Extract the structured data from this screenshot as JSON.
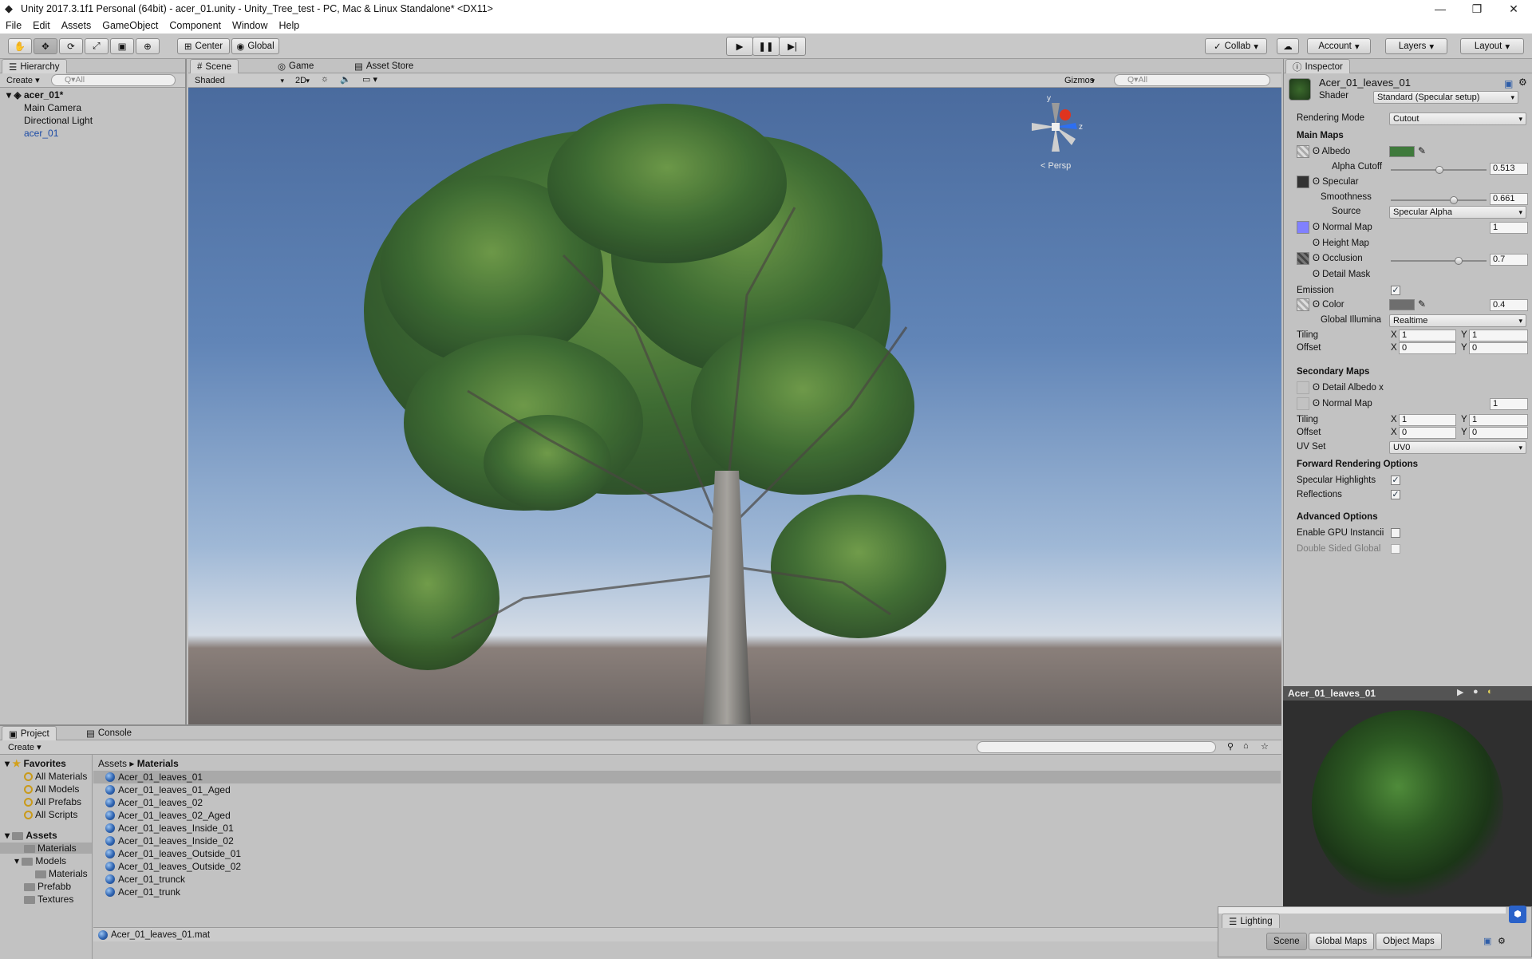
{
  "window": {
    "title": "Unity 2017.3.1f1 Personal (64bit) - acer_01.unity - Unity_Tree_test - PC, Mac & Linux Standalone* <DX11>",
    "controls": [
      "—",
      "❐",
      "✕"
    ]
  },
  "menu": [
    "File",
    "Edit",
    "Assets",
    "GameObject",
    "Component",
    "Window",
    "Help"
  ],
  "toolbar": {
    "pivot": "Center",
    "space": "Global",
    "collab": "Collab",
    "account": "Account",
    "layers": "Layers",
    "layout": "Layout"
  },
  "hierarchy": {
    "tab": "Hierarchy",
    "create": "Create",
    "search_placeholder": "Q▾All",
    "scene": "acer_01*",
    "items": [
      "Main Camera",
      "Directional Light",
      "acer_01"
    ]
  },
  "scene": {
    "tabs": [
      "Scene",
      "Game",
      "Asset Store"
    ],
    "shading": "Shaded",
    "mode2d": "2D",
    "gizmos": "Gizmos",
    "search_placeholder": "Q▾All",
    "persp": "< Persp",
    "axes": {
      "y": "y",
      "z": "z"
    }
  },
  "inspector": {
    "tab": "Inspector",
    "material": "Acer_01_leaves_01",
    "shader_label": "Shader",
    "shader": "Standard (Specular setup)",
    "rendering_mode_label": "Rendering Mode",
    "rendering_mode": "Cutout",
    "main_maps": "Main Maps",
    "albedo": "Albedo",
    "alpha_cutoff": "Alpha Cutoff",
    "alpha_cutoff_value": "0.513",
    "specular": "Specular",
    "smoothness": "Smoothness",
    "smoothness_value": "0.661",
    "source": "Source",
    "source_value": "Specular Alpha",
    "normal_map": "Normal Map",
    "normal_value": "1",
    "height_map": "Height Map",
    "occlusion": "Occlusion",
    "occlusion_value": "0.7",
    "detail_mask": "Detail Mask",
    "emission": "Emission",
    "color": "Color",
    "color_value": "0.4",
    "gi": "Global Illumina",
    "gi_value": "Realtime",
    "tiling": "Tiling",
    "offset": "Offset",
    "x": "X",
    "y": "Y",
    "tiling_x": "1",
    "tiling_y": "1",
    "offset_x": "0",
    "offset_y": "0",
    "secondary_maps": "Secondary Maps",
    "detail_albedo": "Detail Albedo x",
    "sec_normal": "Normal Map",
    "sec_normal_value": "1",
    "sec_tiling_x": "1",
    "sec_tiling_y": "1",
    "sec_offset_x": "0",
    "sec_offset_y": "0",
    "uv_set": "UV Set",
    "uv_set_value": "UV0",
    "forward": "Forward Rendering Options",
    "spec_highlights": "Specular Highlights",
    "reflections": "Reflections",
    "advanced": "Advanced Options",
    "gpu_instancing": "Enable GPU Instancii",
    "double_sided": "Double Sided Global",
    "preview_title": "Acer_01_leaves_01"
  },
  "colors": {
    "albedo": "#3f7a3c",
    "specular": "#333333",
    "normal": "#8080ff",
    "emission": "#6e6e6e"
  },
  "project": {
    "tabs": [
      "Project",
      "Console"
    ],
    "create": "Create",
    "favorites": "Favorites",
    "fav_items": [
      "All Materials",
      "All Models",
      "All Prefabs",
      "All Scripts"
    ],
    "assets": "Assets",
    "tree": [
      "Materials",
      "Models",
      "Materials",
      "Prefabb",
      "Textures"
    ],
    "breadcrumb_root": "Assets",
    "breadcrumb_sep": "▸",
    "breadcrumb_current": "Materials",
    "files": [
      "Acer_01_leaves_01",
      "Acer_01_leaves_01_Aged",
      "Acer_01_leaves_02",
      "Acer_01_leaves_02_Aged",
      "Acer_01_leaves_Inside_01",
      "Acer_01_leaves_Inside_02",
      "Acer_01_leaves_Outside_01",
      "Acer_01_leaves_Outside_02",
      "Acer_01_trunck",
      "Acer_01_trunk"
    ],
    "status": "Acer_01_leaves_01.mat"
  },
  "lighting": {
    "title": "Lighting",
    "tabs": [
      "Scene",
      "Global Maps",
      "Object Maps"
    ]
  }
}
